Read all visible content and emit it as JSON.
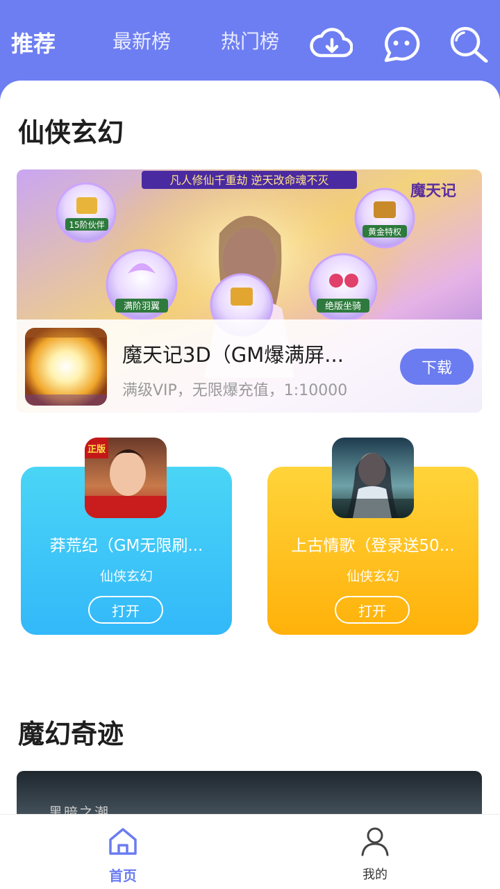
{
  "header": {
    "tabs": [
      {
        "label": "推荐",
        "active": true
      },
      {
        "label": "最新榜",
        "active": false
      },
      {
        "label": "热门榜",
        "active": false
      }
    ],
    "icons": [
      "download-cloud-icon",
      "chat-bubble-icon",
      "search-icon"
    ]
  },
  "sections": [
    {
      "title": "仙侠玄幻",
      "featured": {
        "banner_caption": "凡人修仙千重劫 逆天改命魂不灭",
        "banner_logo": "魔天记",
        "banner_badges": [
          "15阶伙伴",
          "黄金特权",
          "满阶羽翼",
          "绝版坐骑"
        ],
        "title": "魔天记3D（GM爆满屏...",
        "subtitle": "满级VIP，无限爆充值，1:10000",
        "button": "下载"
      },
      "cards": [
        {
          "title": "莽荒纪（GM无限刷...",
          "category": "仙侠玄幻",
          "button": "打开",
          "color": "#3cc6f7",
          "icon_badge": "正版"
        },
        {
          "title": "上古情歌（登录送50...",
          "category": "仙侠玄幻",
          "button": "打开",
          "color": "#ffc21f"
        }
      ]
    },
    {
      "title": "魔幻奇迹",
      "banner_text": "黑暗之潮"
    }
  ],
  "bottom_nav": [
    {
      "label": "首页",
      "icon": "home-icon",
      "active": true
    },
    {
      "label": "我的",
      "icon": "user-icon",
      "active": false
    }
  ],
  "colors": {
    "accent": "#6b7cf0",
    "blue_card": "#3cc6f7",
    "yellow_card": "#ffc21f"
  }
}
